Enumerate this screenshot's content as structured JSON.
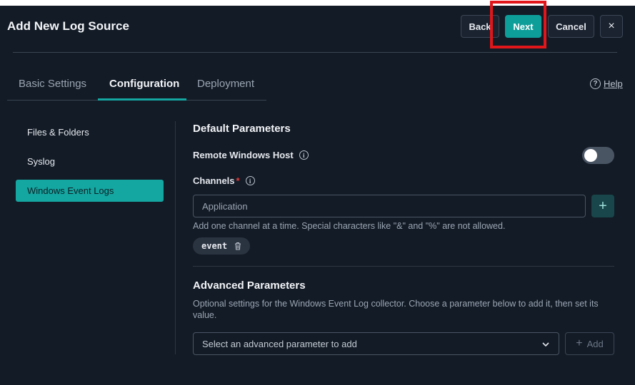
{
  "header": {
    "title": "Add New Log Source",
    "back_label": "Back",
    "next_label": "Next",
    "cancel_label": "Cancel",
    "close_icon": "×"
  },
  "tabs": [
    {
      "label": "Basic Settings",
      "active": false
    },
    {
      "label": "Configuration",
      "active": true
    },
    {
      "label": "Deployment",
      "active": false
    }
  ],
  "help": {
    "icon": "?",
    "label": "Help"
  },
  "sidebar": {
    "items": [
      {
        "label": "Files & Folders",
        "active": false
      },
      {
        "label": "Syslog",
        "active": false
      },
      {
        "label": "Windows Event Logs",
        "active": true
      }
    ]
  },
  "default_params": {
    "title": "Default Parameters",
    "remote_host_label": "Remote Windows Host",
    "remote_host_enabled": false,
    "channels_label": "Channels",
    "required_mark": "*",
    "channel_placeholder": "Application",
    "add_channel_icon": "+",
    "hint": "Add one channel at a time. Special characters like \"&\" and \"%\" are not allowed.",
    "chips": [
      "event"
    ]
  },
  "advanced_params": {
    "title": "Advanced Parameters",
    "description": "Optional settings for the Windows Event Log collector. Choose a parameter below to add it, then set its value.",
    "select_placeholder": "Select an advanced parameter to add",
    "add_icon": "+",
    "add_label": "Add"
  },
  "colors": {
    "background": "#131b26",
    "accent": "#14a6a1",
    "highlight": "#e0161b"
  }
}
